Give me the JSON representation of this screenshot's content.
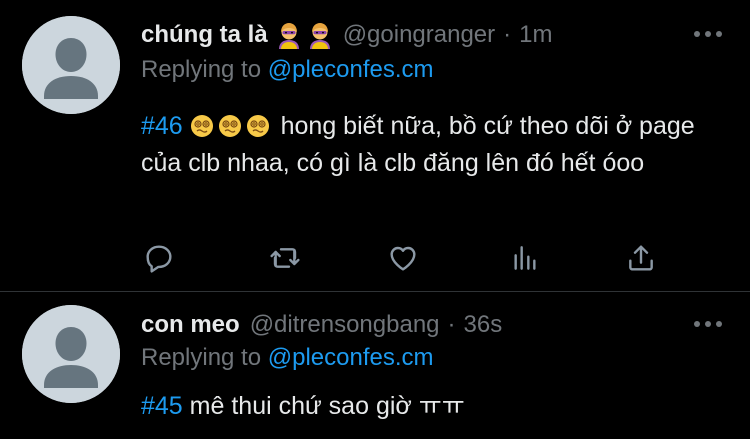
{
  "tweets": [
    {
      "display_name": "chúng ta là",
      "name_emojis": [
        "superhero-woman-emoji",
        "superhero-woman-emoji"
      ],
      "handle": "@goingranger",
      "separator": "·",
      "time": "1m",
      "replying_prefix": "Replying to",
      "replying_mention": "@pleconfes.cm",
      "hashtag": "#46",
      "text_emojis": [
        "woozy-face-emoji",
        "woozy-face-emoji",
        "woozy-face-emoji"
      ],
      "body": "hong biết nữa, bồ cứ theo dõi ở page của clb nhaa, có gì là clb đăng lên đó hết óoo",
      "actions": [
        "reply-icon",
        "retweet-icon",
        "like-icon",
        "analytics-icon",
        "share-icon"
      ]
    },
    {
      "display_name": "con meo",
      "handle": "@ditrensongbang",
      "separator": "·",
      "time": "36s",
      "replying_prefix": "Replying to",
      "replying_mention": "@pleconfes.cm",
      "hashtag": "#45",
      "body": "mê thui chứ sao giờ ㅠㅠ"
    }
  ],
  "colors": {
    "background": "#000000",
    "text": "#e7e9ea",
    "secondary": "#71767b",
    "link": "#1d9bf0",
    "divider": "#2f3336",
    "avatar_bg": "#ccd6dd",
    "avatar_fg": "#66757f"
  }
}
